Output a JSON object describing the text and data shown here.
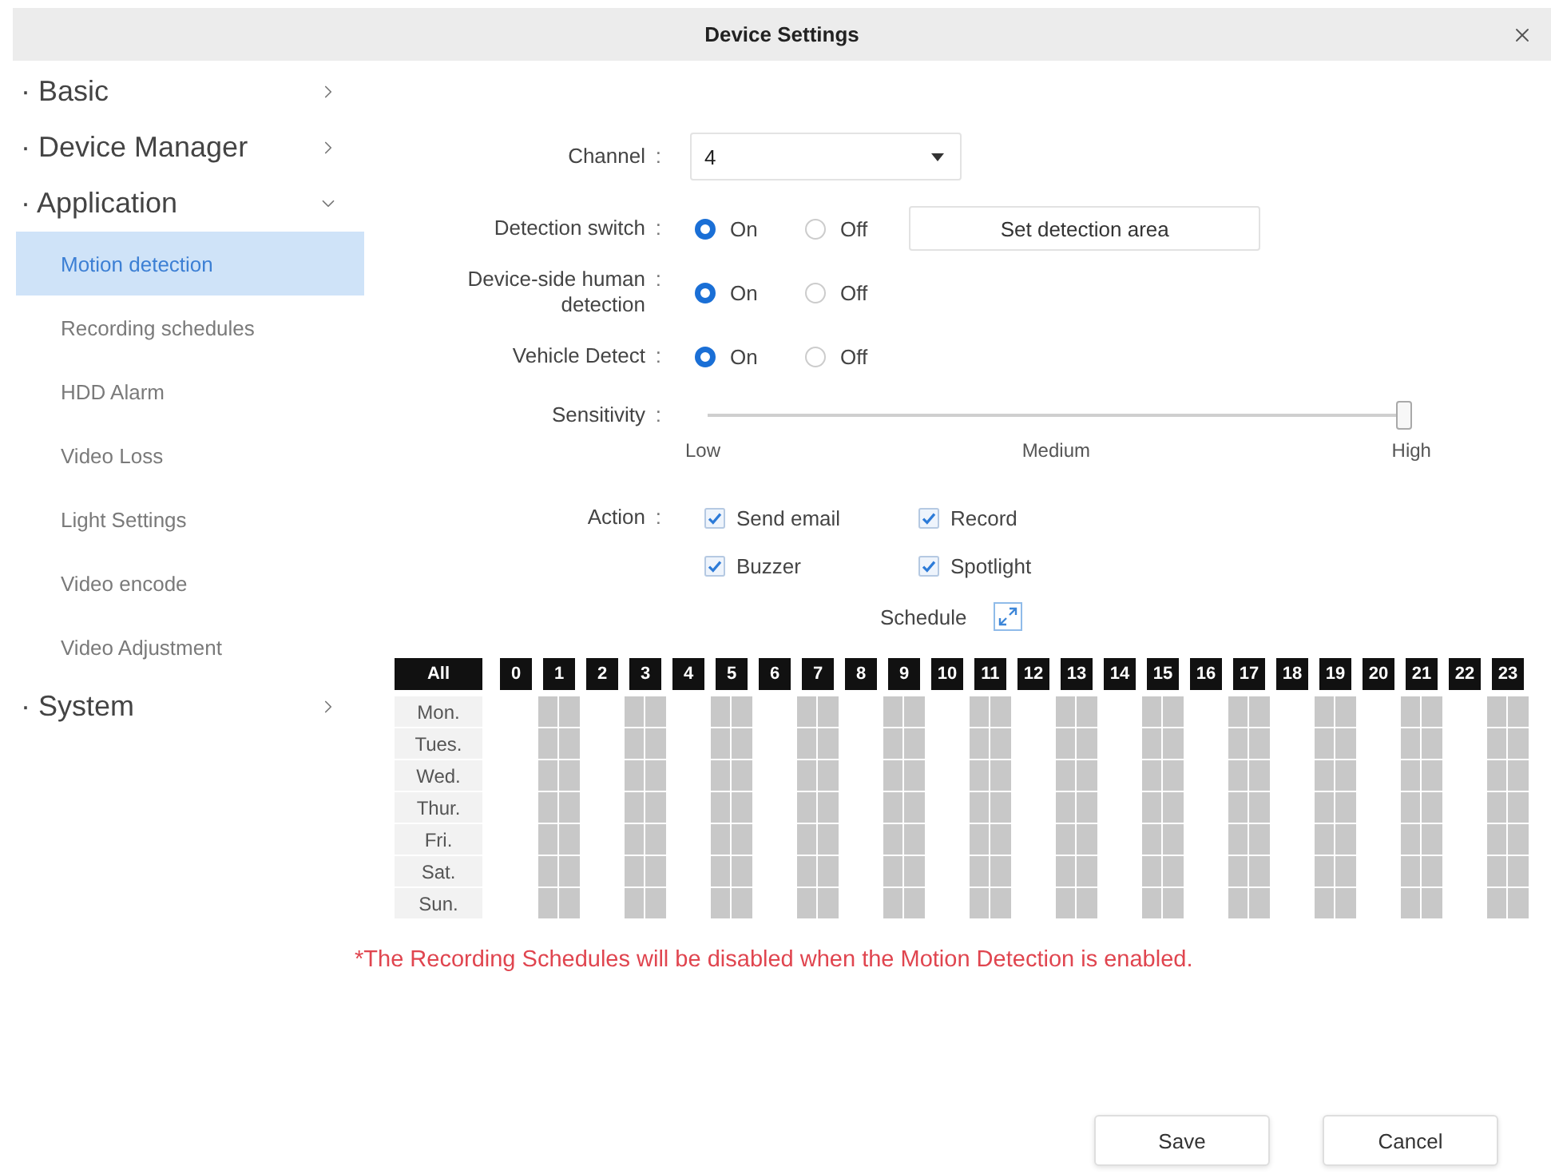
{
  "window": {
    "title": "Device Settings"
  },
  "sidebar": {
    "groups": [
      {
        "label": "· Basic",
        "expanded": false
      },
      {
        "label": "· Device Manager",
        "expanded": false
      },
      {
        "label": "· Application",
        "expanded": true,
        "children": [
          {
            "label": "Motion detection",
            "selected": true
          },
          {
            "label": "Recording schedules",
            "selected": false
          },
          {
            "label": "HDD Alarm",
            "selected": false
          },
          {
            "label": "Video Loss",
            "selected": false
          },
          {
            "label": "Light Settings",
            "selected": false
          },
          {
            "label": "Video encode",
            "selected": false
          },
          {
            "label": "Video Adjustment",
            "selected": false
          }
        ]
      },
      {
        "label": "· System",
        "expanded": false
      }
    ]
  },
  "form": {
    "rows": [
      {
        "kind": "select",
        "label": "Channel",
        "colon": ":",
        "value": "4"
      },
      {
        "kind": "radio",
        "label": "Detection switch",
        "colon": ":",
        "options": [
          {
            "label": "On",
            "selected": true
          },
          {
            "label": "Off",
            "selected": false
          }
        ],
        "button": "Set detection area"
      },
      {
        "kind": "radio",
        "label": "Device-side human detection",
        "colon": ":",
        "options": [
          {
            "label": "On",
            "selected": true
          },
          {
            "label": "Off",
            "selected": false
          }
        ]
      },
      {
        "kind": "radio",
        "label": "Vehicle Detect",
        "colon": ":",
        "options": [
          {
            "label": "On",
            "selected": true
          },
          {
            "label": "Off",
            "selected": false
          }
        ]
      },
      {
        "kind": "slider",
        "label": "Sensitivity",
        "colon": ":",
        "level": 1,
        "ticks": [
          "Low",
          "Medium",
          "High"
        ]
      },
      {
        "kind": "checks",
        "label": "Action",
        "colon": ":",
        "options": [
          {
            "label": "Send email",
            "checked": true
          },
          {
            "label": "Record",
            "checked": true
          },
          {
            "label": "Buzzer",
            "checked": true
          },
          {
            "label": "Spotlight",
            "checked": true
          }
        ]
      }
    ]
  },
  "schedule": {
    "title": "Schedule",
    "all": "All",
    "hours": [
      "0",
      "1",
      "2",
      "3",
      "4",
      "5",
      "6",
      "7",
      "8",
      "9",
      "10",
      "11",
      "12",
      "13",
      "14",
      "15",
      "16",
      "17",
      "18",
      "19",
      "20",
      "21",
      "22",
      "23"
    ],
    "days": [
      {
        "label": "Mon.",
        "slots": [
          false,
          true,
          false,
          true,
          false,
          true,
          false,
          true,
          false,
          true,
          false,
          true,
          false,
          true,
          false,
          true,
          false,
          true,
          false,
          true,
          false,
          true,
          false,
          true
        ]
      },
      {
        "label": "Tues.",
        "slots": [
          false,
          true,
          false,
          true,
          false,
          true,
          false,
          true,
          false,
          true,
          false,
          true,
          false,
          true,
          false,
          true,
          false,
          true,
          false,
          true,
          false,
          true,
          false,
          true
        ]
      },
      {
        "label": "Wed.",
        "slots": [
          false,
          true,
          false,
          true,
          false,
          true,
          false,
          true,
          false,
          true,
          false,
          true,
          false,
          true,
          false,
          true,
          false,
          true,
          false,
          true,
          false,
          true,
          false,
          true
        ]
      },
      {
        "label": "Thur.",
        "slots": [
          false,
          true,
          false,
          true,
          false,
          true,
          false,
          true,
          false,
          true,
          false,
          true,
          false,
          true,
          false,
          true,
          false,
          true,
          false,
          true,
          false,
          true,
          false,
          true
        ]
      },
      {
        "label": "Fri.",
        "slots": [
          false,
          true,
          false,
          true,
          false,
          true,
          false,
          true,
          false,
          true,
          false,
          true,
          false,
          true,
          false,
          true,
          false,
          true,
          false,
          true,
          false,
          true,
          false,
          true
        ]
      },
      {
        "label": "Sat.",
        "slots": [
          false,
          true,
          false,
          true,
          false,
          true,
          false,
          true,
          false,
          true,
          false,
          true,
          false,
          true,
          false,
          true,
          false,
          true,
          false,
          true,
          false,
          true,
          false,
          true
        ]
      },
      {
        "label": "Sun.",
        "slots": [
          false,
          true,
          false,
          true,
          false,
          true,
          false,
          true,
          false,
          true,
          false,
          true,
          false,
          true,
          false,
          true,
          false,
          true,
          false,
          true,
          false,
          true,
          false,
          true
        ]
      }
    ]
  },
  "note": "*The Recording Schedules will be disabled when the Motion Detection is enabled.",
  "buttons": [
    {
      "label": "Save"
    },
    {
      "label": "Cancel"
    }
  ]
}
